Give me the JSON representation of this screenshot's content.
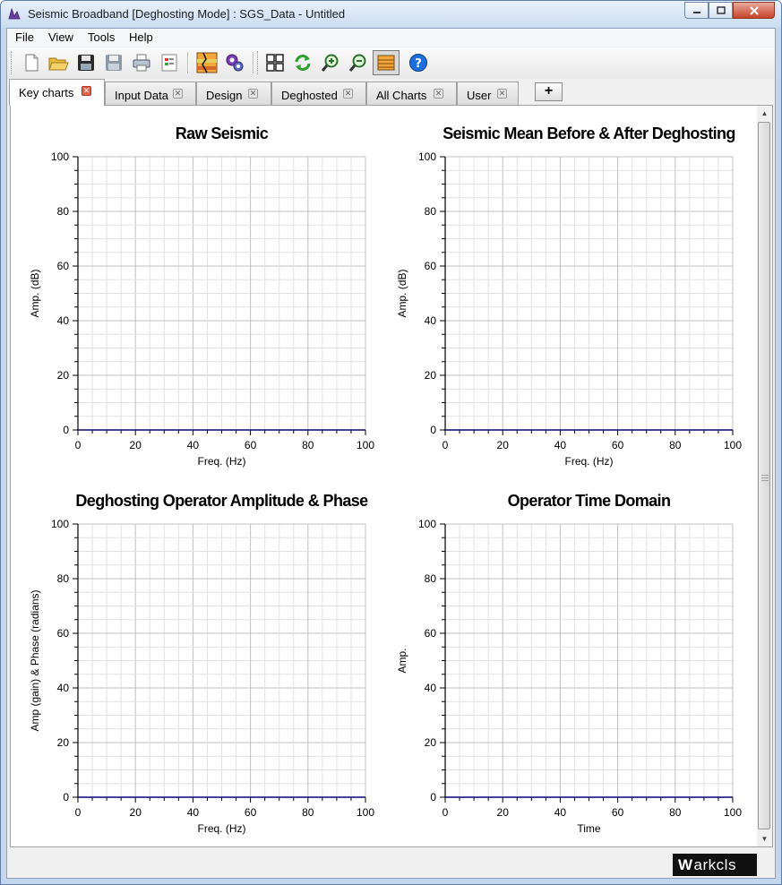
{
  "window": {
    "title": "Seismic Broadband [Deghosting Mode] : SGS_Data - Untitled"
  },
  "menu": [
    "File",
    "View",
    "Tools",
    "Help"
  ],
  "toolbar_icons": [
    "new-file-icon",
    "open-folder-icon",
    "save-icon",
    "save-as-icon",
    "print-icon",
    "report-icon",
    "seismic-design-icon",
    "settings-gears-icon",
    "grid-layout-icon",
    "refresh-icon",
    "zoom-in-icon",
    "zoom-out-icon",
    "panel-view-icon",
    "help-icon"
  ],
  "tabs": [
    {
      "label": "Key charts",
      "active": true
    },
    {
      "label": "Input Data"
    },
    {
      "label": "Design"
    },
    {
      "label": "Deghosted"
    },
    {
      "label": "All Charts"
    },
    {
      "label": "User"
    }
  ],
  "logo": {
    "mark": "W",
    "text": "arkcls"
  },
  "chart_data": [
    {
      "type": "line",
      "title": "Raw Seismic",
      "xlabel": "Freq. (Hz)",
      "ylabel": "Amp. (dB)",
      "xlim": [
        0,
        100
      ],
      "ylim": [
        0,
        100
      ],
      "xticks": [
        "0",
        "20",
        "40",
        "60",
        "80",
        "100"
      ],
      "yticks": [
        "0",
        "20",
        "40",
        "60",
        "80",
        "100"
      ],
      "grid": true,
      "series": [
        {
          "values": [
            [
              0,
              0
            ],
            [
              100,
              0
            ]
          ]
        }
      ]
    },
    {
      "type": "line",
      "title": "Seismic Mean Before & After Deghosting",
      "xlabel": "Freq. (Hz)",
      "ylabel": "Amp. (dB)",
      "xlim": [
        0,
        100
      ],
      "ylim": [
        0,
        100
      ],
      "xticks": [
        "0",
        "20",
        "40",
        "60",
        "80",
        "100"
      ],
      "yticks": [
        "0",
        "20",
        "40",
        "60",
        "80",
        "100"
      ],
      "grid": true,
      "series": [
        {
          "values": [
            [
              0,
              0
            ],
            [
              100,
              0
            ]
          ]
        }
      ]
    },
    {
      "type": "line",
      "title": "Deghosting Operator Amplitude & Phase",
      "xlabel": "Freq. (Hz)",
      "ylabel": "Amp (gain) & Phase (radians)",
      "xlim": [
        0,
        100
      ],
      "ylim": [
        0,
        100
      ],
      "xticks": [
        "0",
        "20",
        "40",
        "60",
        "80",
        "100"
      ],
      "yticks": [
        "0",
        "20",
        "40",
        "60",
        "80",
        "100"
      ],
      "grid": true,
      "series": [
        {
          "values": [
            [
              0,
              0
            ],
            [
              100,
              0
            ]
          ]
        }
      ]
    },
    {
      "type": "line",
      "title": "Operator Time Domain",
      "xlabel": "Time",
      "ylabel": "Amp.",
      "xlim": [
        0,
        100
      ],
      "ylim": [
        0,
        100
      ],
      "xticks": [
        "0",
        "20",
        "40",
        "60",
        "80",
        "100"
      ],
      "yticks": [
        "0",
        "20",
        "40",
        "60",
        "80",
        "100"
      ],
      "grid": true,
      "series": [
        {
          "values": [
            [
              0,
              0
            ],
            [
              100,
              0
            ]
          ]
        }
      ]
    }
  ]
}
